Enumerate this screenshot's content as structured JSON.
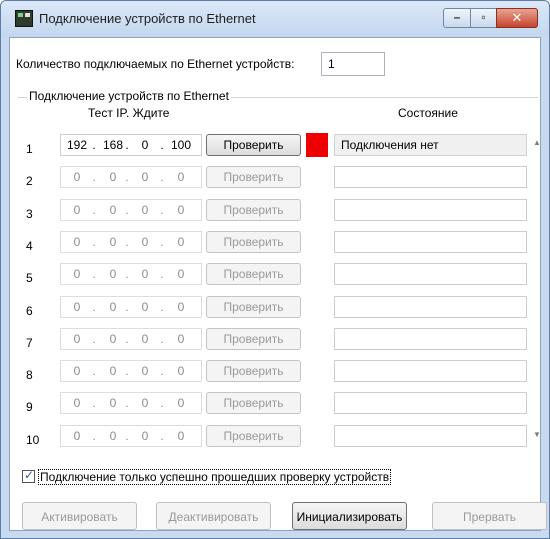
{
  "window": {
    "title": "Подключение устройств по Ethernet",
    "controls": {
      "minimize": "–",
      "maximize": "▫",
      "close": "✕"
    }
  },
  "count": {
    "label": "Количество подключаемых по Ethernet устройств:",
    "value": "1"
  },
  "group": {
    "label": "Подключение устройств по Ethernet",
    "col_ip": "Тест IP. Ждите",
    "col_state": "Состояние"
  },
  "rows": [
    {
      "num": "1",
      "ip": [
        "192",
        "168",
        "0",
        "100"
      ],
      "button": "Проверить",
      "state": "Подключения нет",
      "enabled": true
    },
    {
      "num": "2",
      "ip": [
        "0",
        "0",
        "0",
        "0"
      ],
      "button": "Проверить",
      "state": "",
      "enabled": false
    },
    {
      "num": "3",
      "ip": [
        "0",
        "0",
        "0",
        "0"
      ],
      "button": "Проверить",
      "state": "",
      "enabled": false
    },
    {
      "num": "4",
      "ip": [
        "0",
        "0",
        "0",
        "0"
      ],
      "button": "Проверить",
      "state": "",
      "enabled": false
    },
    {
      "num": "5",
      "ip": [
        "0",
        "0",
        "0",
        "0"
      ],
      "button": "Проверить",
      "state": "",
      "enabled": false
    },
    {
      "num": "6",
      "ip": [
        "0",
        "0",
        "0",
        "0"
      ],
      "button": "Проверить",
      "state": "",
      "enabled": false
    },
    {
      "num": "7",
      "ip": [
        "0",
        "0",
        "0",
        "0"
      ],
      "button": "Проверить",
      "state": "",
      "enabled": false
    },
    {
      "num": "8",
      "ip": [
        "0",
        "0",
        "0",
        "0"
      ],
      "button": "Проверить",
      "state": "",
      "enabled": false
    },
    {
      "num": "9",
      "ip": [
        "0",
        "0",
        "0",
        "0"
      ],
      "button": "Проверить",
      "state": "",
      "enabled": false
    },
    {
      "num": "10",
      "ip": [
        "0",
        "0",
        "0",
        "0"
      ],
      "button": "Проверить",
      "state": "",
      "enabled": false
    }
  ],
  "status_color": "#ee0000",
  "checkbox": {
    "label": "Подключение только успешно прошедших проверку устройств",
    "checked": true
  },
  "buttons": {
    "activate": "Активировать",
    "deactivate": "Деактивировать",
    "initialize": "Инициализировать",
    "abort": "Прервать"
  }
}
